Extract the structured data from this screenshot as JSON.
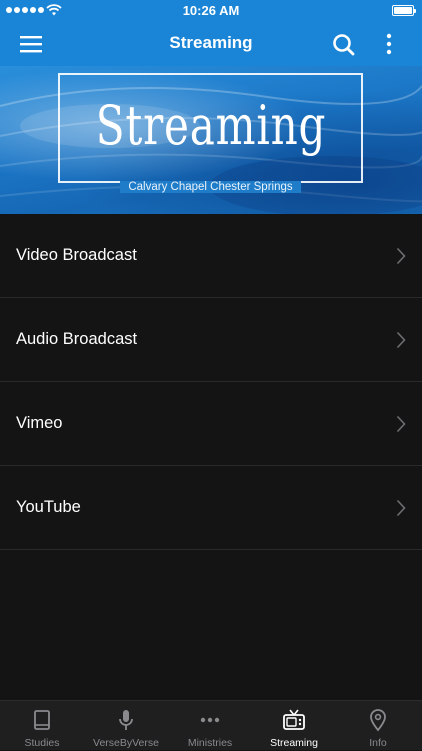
{
  "status_bar": {
    "time": "10:26 AM"
  },
  "nav": {
    "title": "Streaming"
  },
  "banner": {
    "title": "Streaming",
    "subtitle": "Calvary Chapel Chester Springs"
  },
  "list": {
    "items": [
      {
        "label": "Video Broadcast"
      },
      {
        "label": "Audio Broadcast"
      },
      {
        "label": "Vimeo"
      },
      {
        "label": "YouTube"
      }
    ]
  },
  "tabs": [
    {
      "label": "Studies",
      "icon": "book-icon"
    },
    {
      "label": "VerseByVerse",
      "icon": "microphone-icon"
    },
    {
      "label": "Ministries",
      "icon": "dots-icon"
    },
    {
      "label": "Streaming",
      "icon": "tv-icon",
      "active": true
    },
    {
      "label": "Info",
      "icon": "location-pin-icon"
    }
  ],
  "colors": {
    "accent": "#1a85d6",
    "background": "#141415",
    "tab_bar": "#1f1f20",
    "active_tab": "#ffffff",
    "inactive_tab": "#8a8a8e"
  }
}
